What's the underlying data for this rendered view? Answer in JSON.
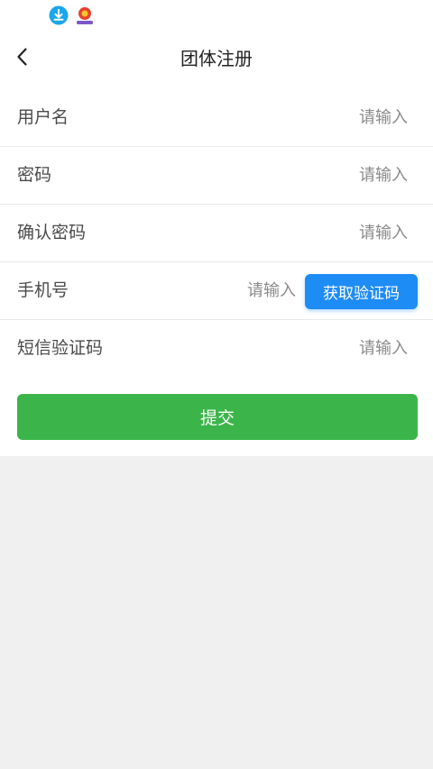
{
  "status_bar": {
    "icons": [
      "download-icon",
      "app-notification-icon"
    ],
    "colors": {
      "download": "#1aa7ec",
      "app": "#e8412c"
    }
  },
  "nav": {
    "title": "团体注册",
    "back_icon": "chevron-left-icon"
  },
  "form": {
    "rows": [
      {
        "label": "用户名",
        "placeholder": "请输入",
        "value": ""
      },
      {
        "label": "密码",
        "placeholder": "请输入",
        "value": ""
      },
      {
        "label": "确认密码",
        "placeholder": "请输入",
        "value": ""
      },
      {
        "label": "手机号",
        "placeholder": "请输入",
        "value": "",
        "action_label": "获取验证码"
      },
      {
        "label": "短信验证码",
        "placeholder": "请输入",
        "value": ""
      }
    ]
  },
  "submit": {
    "label": "提交"
  },
  "colors": {
    "primary_blue": "#1e8cf5",
    "submit_green": "#3bb54a",
    "page_bg": "#f0f0f0"
  }
}
